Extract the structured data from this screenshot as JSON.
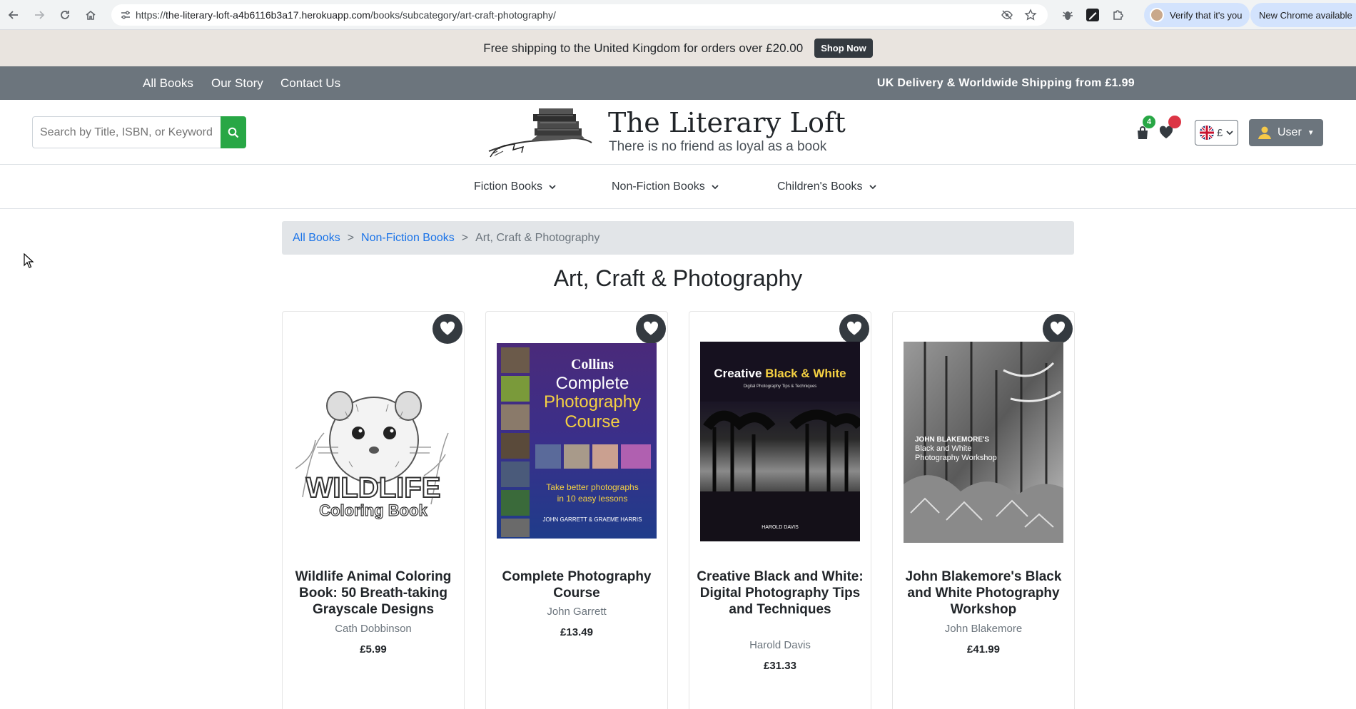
{
  "browser": {
    "url_prefix": "https://",
    "url_host": "the-literary-loft-a4b6116b3a17.herokuapp.com",
    "url_path": "/books/subcategory/art-craft-photography/",
    "verify_label": "Verify that it's you",
    "update_label": "New Chrome available"
  },
  "promo": {
    "text": "Free shipping to the United Kingdom for orders over £20.00",
    "button": "Shop Now"
  },
  "topnav": {
    "links": [
      "All Books",
      "Our Story",
      "Contact Us"
    ],
    "shipping": "UK Delivery & Worldwide Shipping from £1.99"
  },
  "header": {
    "search_placeholder": "Search by Title, ISBN, or Keyword",
    "brand": "The Literary Loft",
    "tagline": "There is no friend as loyal as a book",
    "bag_count": "4",
    "currency": "£",
    "user": "User"
  },
  "catnav": [
    "Fiction Books",
    "Non-Fiction Books",
    "Children's Books"
  ],
  "breadcrumb": {
    "items": [
      "All Books",
      "Non-Fiction Books"
    ],
    "current": "Art, Craft & Photography",
    "separator": ">"
  },
  "page_title": "Art, Craft & Photography",
  "products": [
    {
      "title": "Wildlife Animal Coloring Book: 50 Breath-taking Grayscale Designs",
      "author": "Cath Dobbinson",
      "price": "£5.99",
      "cover_line1": "WILDLIFE",
      "cover_line2": "Coloring Book"
    },
    {
      "title": "Complete Photography Course",
      "author": "John Garrett",
      "price": "£13.49",
      "cover_line1": "Collins",
      "cover_line2": "Complete",
      "cover_line3": "Photography",
      "cover_line4": "Course",
      "cover_line5": "Take better photographs",
      "cover_line6": "in 10 easy lessons",
      "cover_line7": "JOHN GARRETT & GRAEME HARRIS"
    },
    {
      "title": "Creative Black and White: Digital Photography Tips and Techniques",
      "author": "Harold Davis",
      "price": "£31.33",
      "cover_line1": "Creative ",
      "cover_line1b": "Black & White",
      "cover_line2": "Digital Photography Tips & Techniques",
      "cover_line3": "HAROLD DAVIS"
    },
    {
      "title": "John Blakemore's Black and White Photography Workshop",
      "author": "John Blakemore",
      "price": "£41.99",
      "cover_line1": "JOHN BLAKEMORE'S",
      "cover_line2": "Black and White",
      "cover_line3": "Photography Workshop"
    }
  ]
}
